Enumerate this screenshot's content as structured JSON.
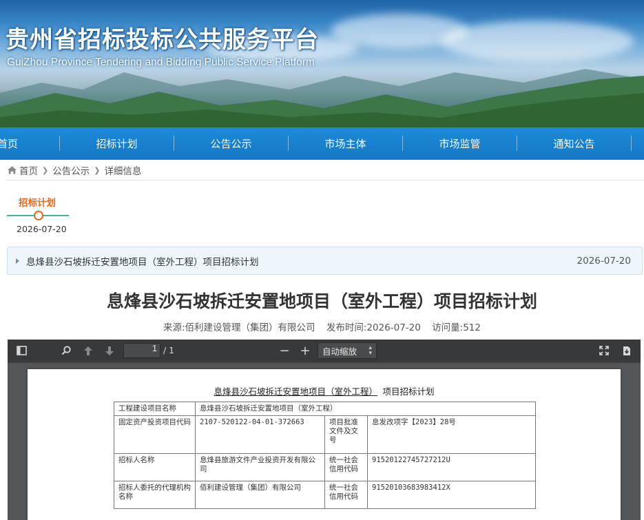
{
  "banner": {
    "title_zh": "贵州省招标投标公共服务平台",
    "title_en": "GuiZhou Province Tendering and Bidding Public Service Platform"
  },
  "nav": {
    "items": [
      "首页",
      "招标计划",
      "公告公示",
      "市场主体",
      "市场监管",
      "通知公告"
    ]
  },
  "breadcrumb": {
    "home": "首页",
    "level1": "公告公示",
    "level2": "详细信息"
  },
  "timeline": {
    "category": "招标计划",
    "date": "2026-07-20"
  },
  "notice": {
    "title": "息烽县沙石坡拆迁安置地项目（室外工程）项目招标计划",
    "date": "2026-07-20"
  },
  "article": {
    "title": "息烽县沙石坡拆迁安置地项目（室外工程）项目招标计划",
    "source": "来源:佰利建设管理（集团）有限公司",
    "publish_time": "发布时间:2026-07-20",
    "visits": "访问量:512"
  },
  "pdf_viewer": {
    "page_current": "1",
    "page_total": "/ 1",
    "zoom": "自动缩放",
    "doc_title_underlined": "息烽县沙石坡拆迁安置地项目（室外工程）",
    "doc_title_rest": " 项目招标计划",
    "rows": [
      {
        "label": "工程建设项目名称",
        "value": "息烽县沙石坡拆迁安置地项目（室外工程）"
      },
      {
        "label": "固定资产投资项目代码",
        "value": "2107-520122-04-01-372663",
        "label2": "项目批准文件及文号",
        "value2": "息发改项字【2023】28号"
      },
      {
        "label": "招标人名称",
        "value": "息烽县旅游文件产业投资开发有限公司",
        "label2": "统一社会信用代码",
        "value2": "91520122745727212U"
      },
      {
        "label": "招标人委托的代理机构名称",
        "value": "佰利建设管理（集团）有限公司",
        "label2": "统一社会信用代码",
        "value2": "91520103683983412X"
      }
    ]
  },
  "colors": {
    "nav_bg": "#1a84d2",
    "accent_orange": "#e8681a",
    "timeline_green": "#45b495"
  }
}
